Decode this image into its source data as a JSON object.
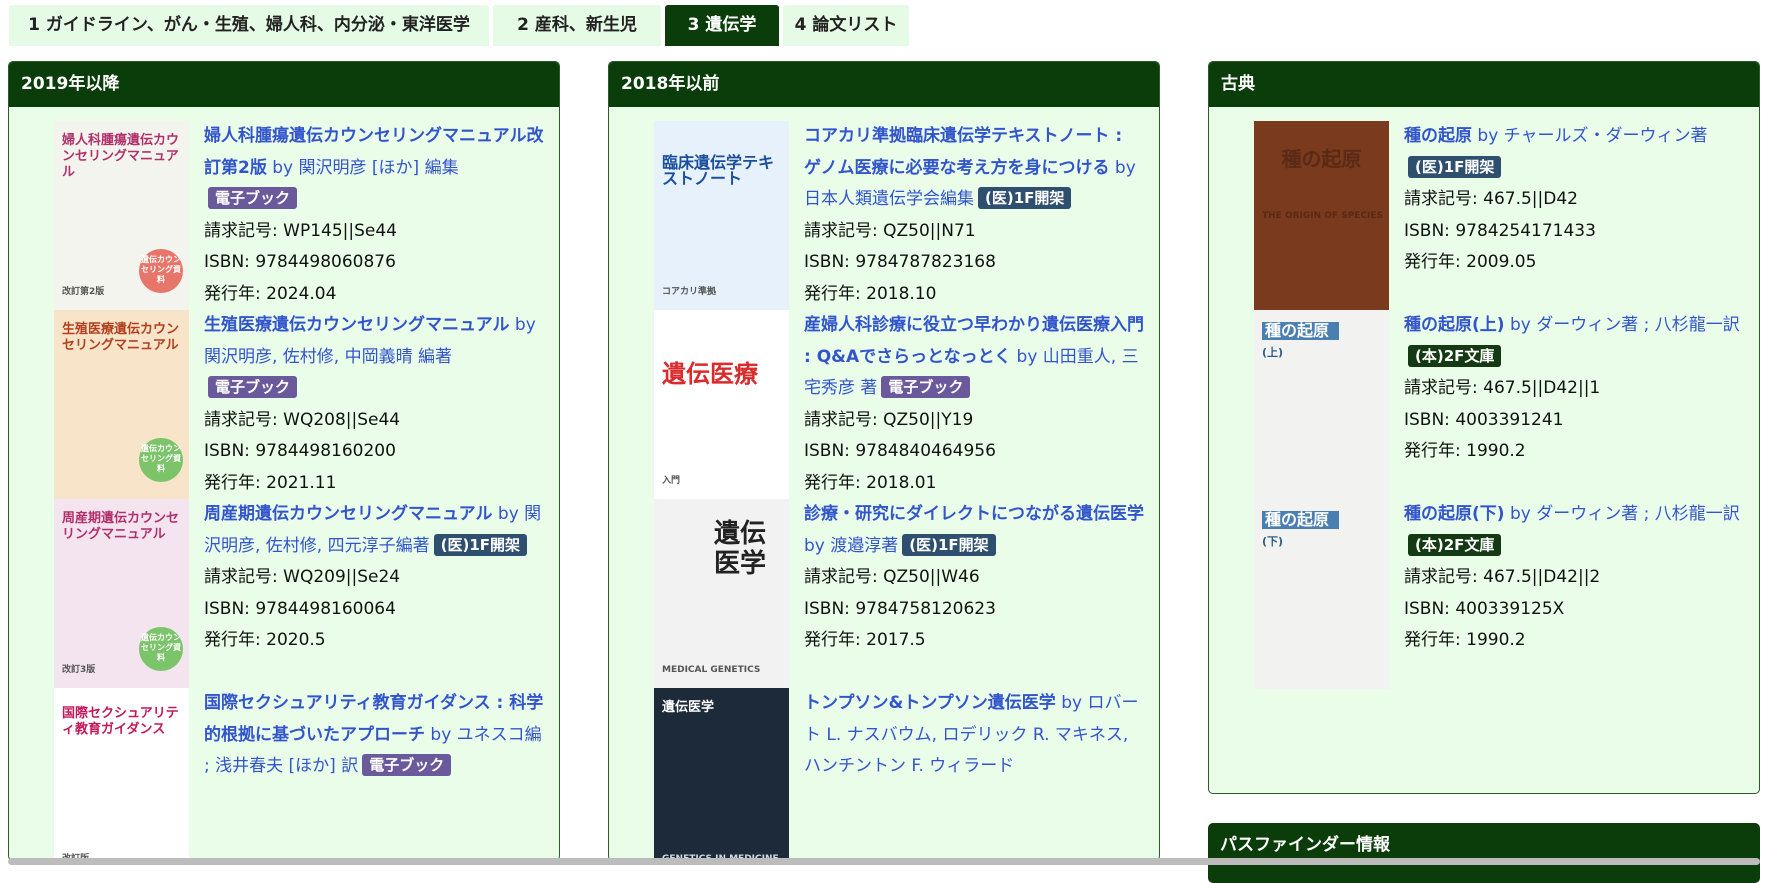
{
  "tabs": [
    {
      "label": "1 ガイドライン、がん・生殖、婦人科、内分泌・東洋医学",
      "active": false
    },
    {
      "label": "2 産科、新生児",
      "active": false
    },
    {
      "label": "3 遺伝学",
      "active": true
    },
    {
      "label": "4 論文リスト",
      "active": false
    }
  ],
  "colors": {
    "accent": "#0b3d0b",
    "panel_bg": "#e9fde9",
    "link": "#3355cc"
  },
  "panels": [
    {
      "title": "2019年以降",
      "books": [
        {
          "title": "婦人科腫瘍遺伝カウンセリングマニュアル改訂第2版",
          "by": " by 関沢明彦 [ほか] 編集",
          "badge": "電子ブック",
          "callno": "請求記号: WP145||Se44",
          "isbn": "ISBN: 9784498060876",
          "year": "発行年: 2024.04",
          "cover": {
            "bg": "#f4f4ef",
            "title": "婦人科腫瘍遺伝カウンセリングマニュアル",
            "sub": "改訂第2版",
            "seal": "遺伝カウンセリング資料"
          }
        },
        {
          "title": "生殖医療遺伝カウンセリングマニュアル",
          "by": " by 関沢明彦, 佐村修, 中岡義晴 編著",
          "badge": "電子ブック",
          "callno": "請求記号: WQ208||Se44",
          "isbn": "ISBN: 9784498160200",
          "year": "発行年: 2021.11",
          "cover": {
            "bg": "#f8e4c8",
            "title": "生殖医療遺伝カウンセリングマニュアル",
            "sub": "",
            "seal": "遺伝カウンセリング資料"
          }
        },
        {
          "title": "周産期遺伝カウンセリングマニュアル",
          "by": " by 関沢明彦, 佐村修, 四元淳子編著",
          "badge": "(医)1F開架",
          "callno": "請求記号: WQ209||Se24",
          "isbn": "ISBN: 9784498160064",
          "year": "発行年: 2020.5",
          "cover": {
            "bg": "#f4e4f0",
            "title": "周産期遺伝カウンセリングマニュアル",
            "sub": "改訂3版",
            "seal": "遺伝カウンセリング資料"
          }
        },
        {
          "title": "国際セクシュアリティ教育ガイダンス : 科学的根拠に基づいたアプローチ",
          "by": " by ユネスコ編 ; 浅井春夫 [ほか] 訳",
          "badge": "電子ブック",
          "callno": "",
          "isbn": "",
          "year": "",
          "cover": {
            "bg": "#ffffff",
            "title": "国際セクシュアリティ教育ガイダンス",
            "sub": "改訂版",
            "seal": ""
          }
        }
      ]
    },
    {
      "title": "2018年以前",
      "books": [
        {
          "title": "コアカリ準拠臨床遺伝学テキストノート : ゲノム医療に必要な考え方を身につける",
          "by": " by 日本人類遺伝学会編集",
          "badge": "(医)1F開架",
          "callno": "請求記号: QZ50||N71",
          "isbn": "ISBN: 9784787823168",
          "year": "発行年: 2018.10",
          "cover": {
            "bg": "#e6f1fb",
            "title": "臨床遺伝学テキストノート",
            "sub": "コアカリ準拠",
            "seal": ""
          }
        },
        {
          "title": "産婦人科診療に役立つ早わかり遺伝医療入門 : Q&Aでさらっとなっとく",
          "by": " by 山田重人, 三宅秀彦 著",
          "badge": "電子ブック",
          "callno": "請求記号: QZ50||Y19",
          "isbn": "ISBN: 9784840464956",
          "year": "発行年: 2018.01",
          "cover": {
            "bg": "#ffffff",
            "title": "遺伝医療",
            "sub": "入門",
            "seal": ""
          }
        },
        {
          "title": "診療・研究にダイレクトにつながる遺伝医学",
          "by": " by 渡邉淳著",
          "badge": "(医)1F開架",
          "callno": "請求記号: QZ50||W46",
          "isbn": "ISBN: 9784758120623",
          "year": "発行年: 2017.5",
          "cover": {
            "bg": "#f2f2f2",
            "title": "遺伝医学",
            "sub": "MEDICAL GENETICS",
            "seal": ""
          }
        },
        {
          "title": "トンプソン&トンプソン遺伝医学",
          "by": " by ロバート L. ナスバウム, ロデリック R. マキネス, ハンチントン F. ウィラード",
          "badge": "",
          "callno": "",
          "isbn": "",
          "year": "",
          "cover": {
            "bg": "#1d2a3a",
            "title": "遺伝医学",
            "sub": "GENETICS IN MEDICINE",
            "seal": ""
          }
        }
      ]
    },
    {
      "title": "古典",
      "books": [
        {
          "title": "種の起原",
          "by": " by チャールズ・ダーウィン著",
          "badge": "(医)1F開架",
          "callno": "請求記号: 467.5||D42",
          "isbn": "ISBN: 9784254171433",
          "year": "発行年: 2009.05",
          "cover": {
            "bg": "#7a3a1e",
            "title": "種の起原",
            "sub": "THE ORIGIN OF SPECIES",
            "seal": ""
          }
        },
        {
          "title": "種の起原(上)",
          "by": " by ダーウィン著 ; 八杉龍一訳",
          "badge": "(本)2F文庫",
          "callno": "請求記号: 467.5||D42||1",
          "isbn": "ISBN: 4003391241",
          "year": "発行年: 1990.2",
          "cover": {
            "bg": "#f2f2f0",
            "title": "種の起原",
            "sub": "(上)",
            "seal": ""
          }
        },
        {
          "title": "種の起原(下)",
          "by": " by ダーウィン著 ; 八杉龍一訳",
          "badge": "(本)2F文庫",
          "callno": "請求記号: 467.5||D42||2",
          "isbn": "ISBN: 400339125X",
          "year": "発行年: 1990.2",
          "cover": {
            "bg": "#f2f2f0",
            "title": "種の起原",
            "sub": "(下)",
            "seal": ""
          }
        }
      ]
    }
  ],
  "pathfinder": {
    "title": "パスファインダー情報"
  }
}
